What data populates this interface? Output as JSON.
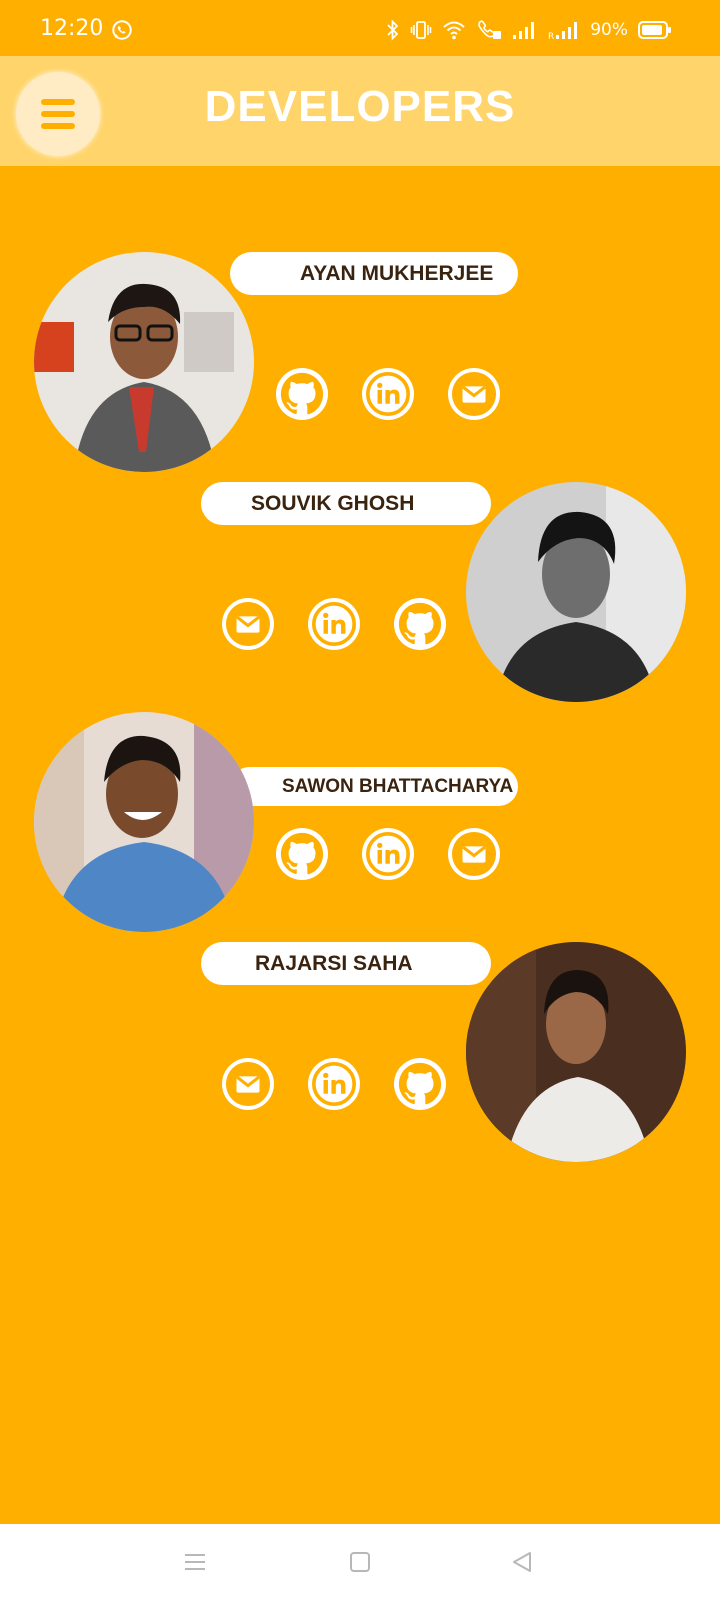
{
  "status_bar": {
    "time": "12:20",
    "battery": "90%",
    "icons": [
      "whatsapp-icon",
      "bluetooth-icon",
      "vibrate-icon",
      "wifi-icon",
      "volte-icon",
      "signal-icon",
      "signal-roaming-icon",
      "battery-icon"
    ]
  },
  "app_bar": {
    "title": "DEVELOPERS",
    "menu_icon": "hamburger-icon"
  },
  "developers": [
    {
      "name": "AYAN MUKHERJEE",
      "icons": [
        "github-icon",
        "linkedin-icon",
        "mail-icon"
      ]
    },
    {
      "name": "SOUVIK GHOSH",
      "icons": [
        "mail-icon",
        "linkedin-icon",
        "github-icon"
      ]
    },
    {
      "name": "SAWON BHATTACHARYA",
      "icons": [
        "github-icon",
        "linkedin-icon",
        "mail-icon"
      ]
    },
    {
      "name": "RAJARSI SAHA",
      "icons": [
        "mail-icon",
        "linkedin-icon",
        "github-icon"
      ]
    }
  ],
  "nav_bar": {
    "icons": [
      "recents-icon",
      "home-icon",
      "back-icon"
    ]
  },
  "colors": {
    "background": "#FFAF00",
    "app_bar": "#FFD46A",
    "icon_orange": "#FFAF00",
    "name_text": "#3A2410"
  }
}
